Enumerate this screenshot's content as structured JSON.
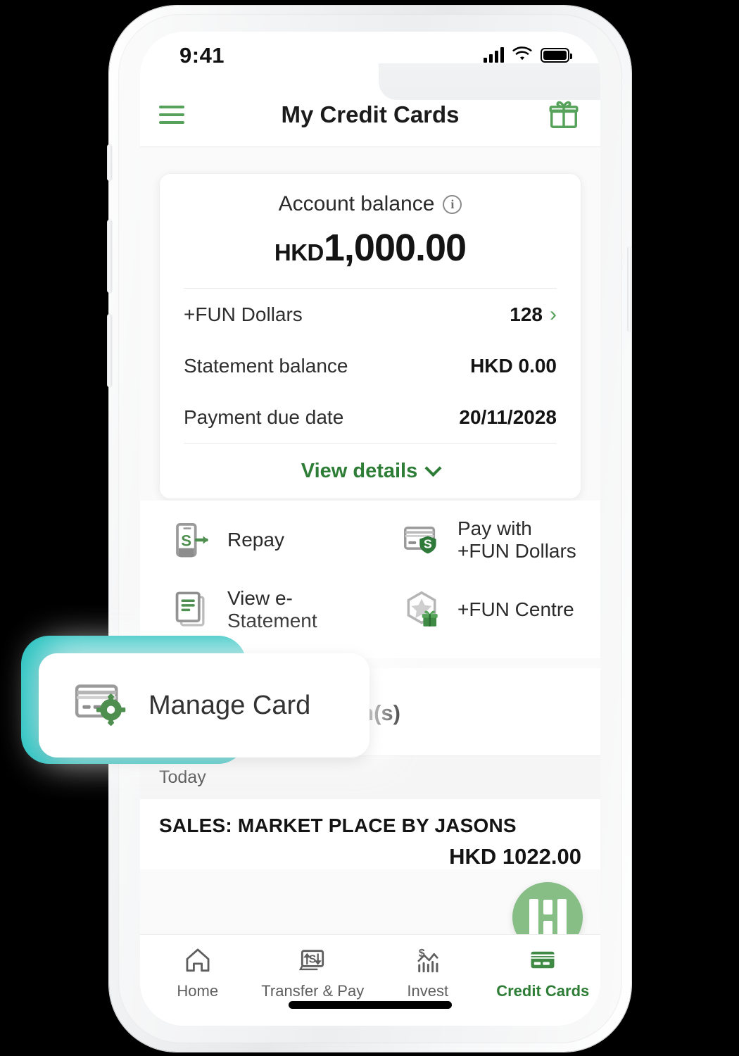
{
  "device": {
    "status_bar": {
      "time": "9:41",
      "signal_icon": "cellular-signal-icon",
      "wifi_icon": "wifi-icon",
      "battery_icon": "battery-full-icon"
    }
  },
  "header": {
    "menu_icon": "hamburger-menu-icon",
    "title": "My Credit Cards",
    "rewards_icon": "gift-icon"
  },
  "balance_card": {
    "title": "Account balance",
    "info_icon": "info-icon",
    "currency": "HKD",
    "amount": "1,000.00",
    "rows": [
      {
        "label": "+FUN Dollars",
        "value": "128",
        "chevron": "chevron-right-icon"
      },
      {
        "label": "Statement balance",
        "value": "HKD 0.00"
      },
      {
        "label": "Payment due date",
        "value": "20/11/2028"
      }
    ],
    "view_details": "View details",
    "view_details_icon": "chevron-down-icon"
  },
  "quick_actions": [
    {
      "label": "Repay",
      "icon": "repay-phone-dollar-icon"
    },
    {
      "label": "Pay with\n+FUN Dollars",
      "line1": "Pay with",
      "line2": "+FUN Dollars",
      "icon": "card-dollar-shield-icon"
    },
    {
      "label": "View e-\nStatement",
      "line1": "View e-",
      "line2": "Statement",
      "icon": "document-statement-icon"
    },
    {
      "label": "+FUN Centre",
      "line1": "+FUN Centre",
      "line2": "",
      "icon": "star-gift-badge-icon"
    }
  ],
  "callout": {
    "label": "Manage Card",
    "icon": "card-gear-icon",
    "highlight_color": "#1fbfbd"
  },
  "transactions": {
    "section_title": "Recent transaction(s)",
    "day_group": "Today",
    "items": [
      {
        "name": "SALES: MARKET PLACE BY JASONS",
        "amount": "HKD 1022.00"
      }
    ]
  },
  "fab": {
    "icon": "hsbc-hexagon-icon"
  },
  "tabbar": {
    "items": [
      {
        "label": "Home",
        "icon": "home-icon",
        "active": false
      },
      {
        "label": "Transfer & Pay",
        "icon": "transfer-pay-icon",
        "active": false
      },
      {
        "label": "Invest",
        "icon": "invest-chart-icon",
        "active": false
      },
      {
        "label": "Credit Cards",
        "icon": "credit-card-icon",
        "active": true
      }
    ]
  },
  "colors": {
    "brand_green": "#56a25a",
    "accent_green": "#2e7d36",
    "bar_green": "#0ab03c",
    "teal": "#1fbfbd",
    "fab_green": "#86be86"
  }
}
